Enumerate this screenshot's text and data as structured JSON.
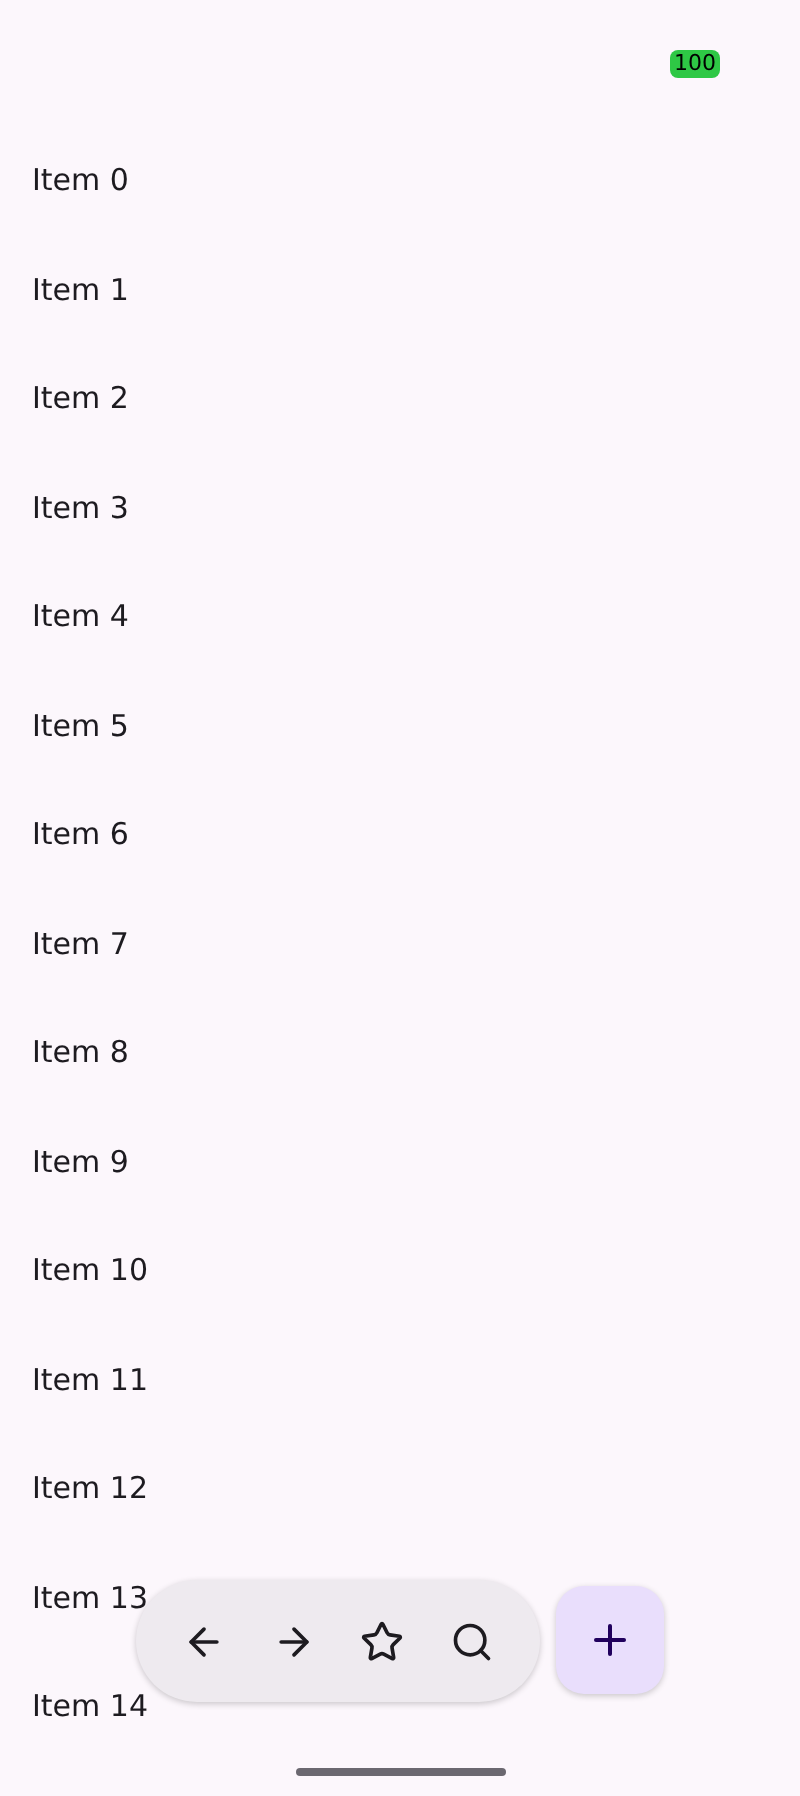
{
  "status_bar": {
    "battery": "100"
  },
  "items": [
    "Item 0",
    "Item 1",
    "Item 2",
    "Item 3",
    "Item 4",
    "Item 5",
    "Item 6",
    "Item 7",
    "Item 8",
    "Item 9",
    "Item 10",
    "Item 11",
    "Item 12",
    "Item 13",
    "Item 14"
  ]
}
